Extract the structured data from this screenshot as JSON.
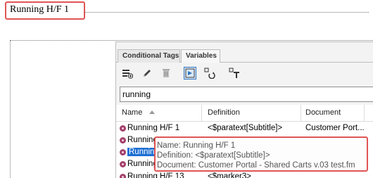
{
  "page_header": {
    "label": "Running H/F 1"
  },
  "panel": {
    "tabs": [
      {
        "label": "Conditional Tags",
        "active": false
      },
      {
        "label": "Variables",
        "active": true
      }
    ],
    "toolbar": {
      "buttons": [
        {
          "icon": "create-variable-icon"
        },
        {
          "icon": "edit-pencil-icon"
        },
        {
          "icon": "delete-trash-icon"
        },
        {
          "icon": "insert-variable-icon",
          "active": true
        },
        {
          "icon": "convert-variable-icon"
        },
        {
          "icon": "convert-to-text-icon"
        }
      ]
    },
    "search": {
      "value": "running"
    },
    "columns": {
      "name": "Name",
      "definition": "Definition",
      "document": "Document"
    },
    "rows": [
      {
        "name": "Running H/F 1",
        "definition": "<$paratext[Subtitle]>",
        "document": "Customer Port..."
      },
      {
        "name": "Running",
        "definition": "",
        "document": ""
      },
      {
        "name": "Runnin",
        "definition": "",
        "document": "",
        "selected": true
      },
      {
        "name": "Running",
        "definition": "",
        "document": ""
      },
      {
        "name": "Running H/F 13",
        "definition": "<$marker3>",
        "document": ""
      }
    ]
  },
  "tooltip": {
    "name_line": "Name: Running H/F 1",
    "definition_line": "Definition: <$paratext[Subtitle]>",
    "document_line": "Document: Customer Portal - Shared Carts v.03 test.fm"
  },
  "colors": {
    "highlight_border": "#e05555",
    "selection": "#1e6fd3",
    "variable_bullet": "#a2416b"
  }
}
